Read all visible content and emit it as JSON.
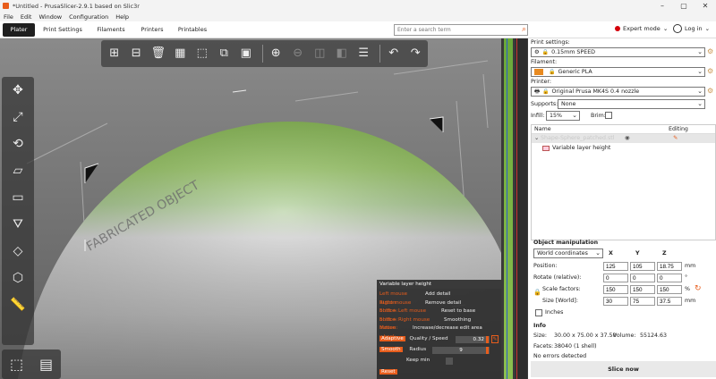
{
  "window": {
    "title": "*Untitled - PrusaSlicer-2.9.1 based on Slic3r",
    "controls": [
      "–",
      "▢",
      "✕"
    ]
  },
  "menu": [
    "File",
    "Edit",
    "Window",
    "Configuration",
    "Help"
  ],
  "tabs": [
    "Plater",
    "Print Settings",
    "Filaments",
    "Printers",
    "Printables"
  ],
  "search": {
    "placeholder": "Enter a search term"
  },
  "mode": {
    "label": "Expert mode",
    "color": "#d4000a"
  },
  "login": {
    "label": "Log in"
  },
  "viewport": {
    "model_text": "FABRICATED OBJECT",
    "accent": "#e85d1c",
    "model_colors": [
      "#6aa83a",
      "#cfcfcf"
    ]
  },
  "toolbar": {
    "icons": [
      "add-icon",
      "delete-icon",
      "delete-all-icon",
      "arrange-icon",
      "split-icon",
      "copy-icon",
      "paste-icon",
      "add-instance-icon",
      "remove-instance-icon",
      "split-objects-icon",
      "split-parts-icon",
      "layers-icon",
      "undo-icon",
      "redo-icon"
    ]
  },
  "left_toolbar": {
    "icons": [
      "move-icon",
      "scale-icon",
      "rotate-icon",
      "place-on-face-icon",
      "cut-icon",
      "paint-supports-icon",
      "seam-icon",
      "measure-icon",
      "emboss-icon"
    ]
  },
  "variable_layer_height": {
    "title": "Variable layer height",
    "rows": [
      {
        "key": "Left mouse button:",
        "value": "Add detail"
      },
      {
        "key": "Right mouse button:",
        "value": "Remove detail"
      },
      {
        "key": "Shift + Left mouse button:",
        "value": "Reset to base"
      },
      {
        "key": "Shift + Right mouse button:",
        "value": "Smoothing"
      },
      {
        "key": "Mouse wheel:",
        "value": "Increase/decrease edit area"
      }
    ],
    "adaptive_label": "Adaptive",
    "quality_label": "Quality / Speed",
    "quality_value": "0.32",
    "smooth_label": "Smooth",
    "radius_label": "Radius",
    "radius_value": "9",
    "keepmin_label": "Keep min",
    "reset_label": "Reset"
  },
  "sidebar": {
    "print_settings_label": "Print settings:",
    "print_profile": "0.15mm SPEED",
    "filament_label": "Filament:",
    "filament_profile": "Generic PLA",
    "filament_color": "#e88a20",
    "printer_label": "Printer:",
    "printer_profile": "Original Prusa MK4S 0.4 nozzle",
    "supports_label": "Supports:",
    "supports_value": "None",
    "infill_label": "Infill:",
    "infill_value": "15%",
    "brim_label": "Brim:",
    "list_headers": {
      "name": "Name",
      "editing": "Editing"
    },
    "object_name": "Shape-Sphere_patched.stl",
    "sub_item": "Variable layer height",
    "object_manipulation": {
      "title": "Object manipulation",
      "coords": "World coordinates",
      "axes": [
        "X",
        "Y",
        "Z"
      ],
      "position_label": "Position:",
      "position": [
        "125",
        "105",
        "18.75"
      ],
      "position_unit": "mm",
      "rotate_label": "Rotate (relative):",
      "rotate": [
        "0",
        "0",
        "0"
      ],
      "rotate_unit": "°",
      "scale_label": "Scale factors:",
      "scale": [
        "150",
        "150",
        "150"
      ],
      "scale_unit": "%",
      "size_label": "Size [World]:",
      "size": [
        "30",
        "75",
        "37.5"
      ],
      "size_unit": "mm",
      "inches_label": "Inches"
    },
    "info": {
      "title": "Info",
      "size_label": "Size:",
      "size_value": "30.00 x 75.00 x 37.50",
      "volume_label": "Volume:",
      "volume_value": "55124.63",
      "facets_label": "Facets:",
      "facets_value": "38040 (1 shell)",
      "errors": "No errors detected"
    },
    "slice_button": "Slice now"
  }
}
